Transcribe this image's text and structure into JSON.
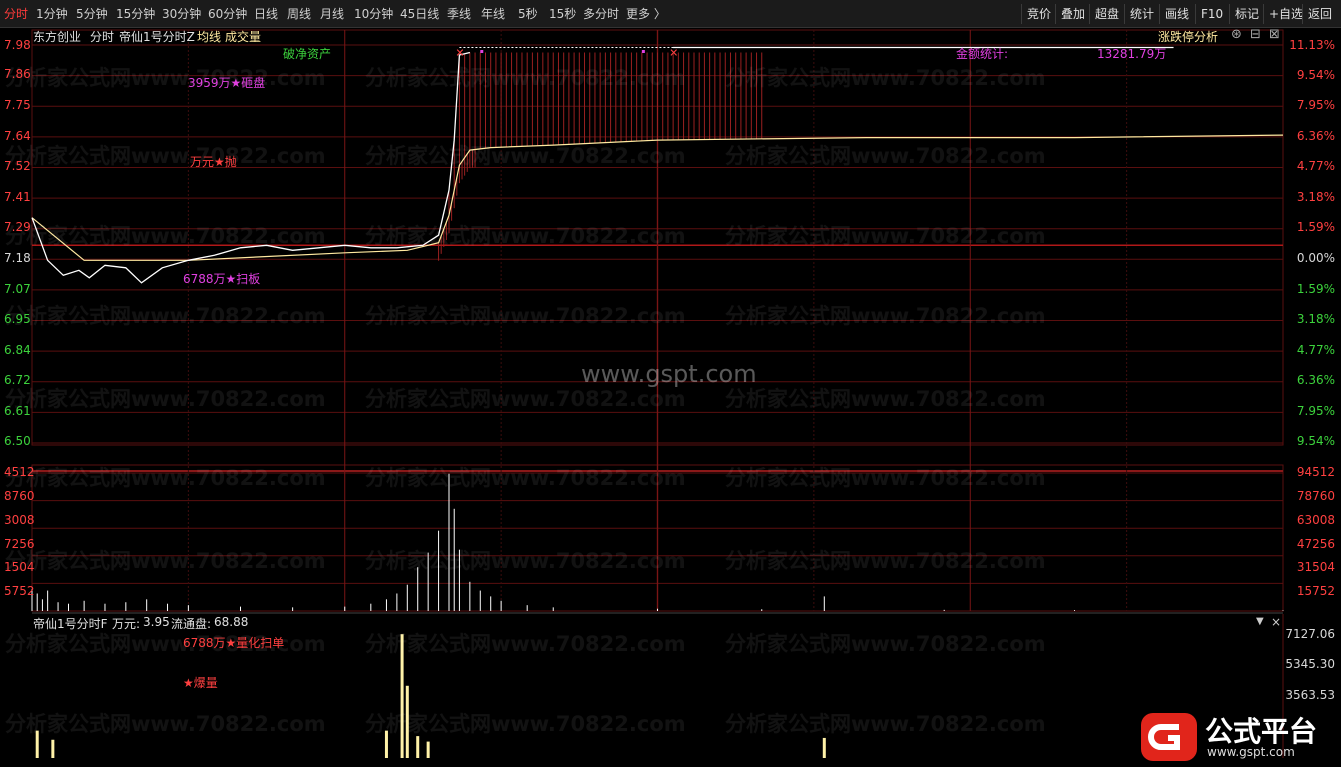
{
  "toolbar": {
    "timeframes": [
      "分时",
      "1分钟",
      "5分钟",
      "15分钟",
      "30分钟",
      "60分钟",
      "日线",
      "周线",
      "月线",
      "10分钟",
      "45日线",
      "季线",
      "年线",
      "5秒",
      "15秒",
      "多分时",
      "更多 〉"
    ],
    "right_buttons": [
      "竞价",
      "叠加",
      "超盘",
      "统计",
      "画线",
      "F10",
      "标记",
      "+自选",
      "返回"
    ]
  },
  "header": {
    "stock": "东方创业",
    "mode": "分时",
    "indicator": "帝仙1号分时Z",
    "avg_label": "均线",
    "vol_label": "成交量",
    "analysis": "涨跌停分析",
    "break_label": "破净资产",
    "amount_label": "金额统计:",
    "amount_value": "13281.79万"
  },
  "annotations": {
    "dump": "3959万★砸盘",
    "sell": "万元★抛",
    "sweep": "6788万★扫板"
  },
  "price_axis": {
    "left": [
      "7.98",
      "7.86",
      "7.75",
      "7.64",
      "7.52",
      "7.41",
      "7.29",
      "7.18",
      "7.07",
      "6.95",
      "6.84",
      "6.72",
      "6.61",
      "6.50"
    ],
    "right": [
      "11.13%",
      "9.54%",
      "7.95%",
      "6.36%",
      "4.77%",
      "3.18%",
      "1.59%",
      "0.00%",
      "1.59%",
      "3.18%",
      "4.77%",
      "6.36%",
      "7.95%",
      "9.54%"
    ]
  },
  "volume_axis": {
    "left": [
      "4512",
      "8760",
      "3008",
      "7256",
      "1504",
      "5752"
    ],
    "right": [
      "94512",
      "78760",
      "63008",
      "47256",
      "31504",
      "15752"
    ]
  },
  "sub": {
    "title": "帝仙1号分时F",
    "wan_label": "万元:",
    "wan_value": "3.95",
    "float_label": "流通盘:",
    "float_value": "68.88",
    "axis": [
      "7127.06",
      "5345.30",
      "3563.53"
    ],
    "ann_top": "6788万★量化扫单",
    "ann_mid": "★爆量"
  },
  "watermark": {
    "text": "分析家公式网www.70822.com",
    "center": "www.gspt.com"
  },
  "logo": {
    "name": "公式平台",
    "url": "www.gspt.com"
  },
  "colors": {
    "up": "#ff4040",
    "down": "#3cd23c",
    "price_line": "#ffffff",
    "avg_line": "#ffe9a0",
    "grid": "#5a0f0f",
    "volume": "#ffffff",
    "sub_bar": "#fff2a8",
    "magenta": "#e040e0"
  },
  "chart_data": {
    "type": "line",
    "prev_close": 7.18,
    "price_range": [
      6.39,
      7.98
    ],
    "minutes": 240,
    "price": [
      [
        0,
        7.29
      ],
      [
        3,
        7.12
      ],
      [
        6,
        7.06
      ],
      [
        9,
        7.08
      ],
      [
        11,
        7.05
      ],
      [
        14,
        7.1
      ],
      [
        18,
        7.09
      ],
      [
        21,
        7.03
      ],
      [
        25,
        7.09
      ],
      [
        30,
        7.12
      ],
      [
        35,
        7.14
      ],
      [
        40,
        7.17
      ],
      [
        45,
        7.18
      ],
      [
        50,
        7.16
      ],
      [
        55,
        7.17
      ],
      [
        60,
        7.18
      ],
      [
        65,
        7.17
      ],
      [
        70,
        7.17
      ],
      [
        75,
        7.18
      ],
      [
        78,
        7.22
      ],
      [
        80,
        7.4
      ],
      [
        81,
        7.6
      ],
      [
        82,
        7.94
      ],
      [
        84,
        7.95
      ],
      [
        240,
        7.95
      ]
    ],
    "avg": [
      [
        0,
        7.29
      ],
      [
        10,
        7.12
      ],
      [
        30,
        7.12
      ],
      [
        60,
        7.15
      ],
      [
        72,
        7.16
      ],
      [
        78,
        7.19
      ],
      [
        80,
        7.3
      ],
      [
        82,
        7.5
      ],
      [
        84,
        7.56
      ],
      [
        88,
        7.57
      ],
      [
        100,
        7.58
      ],
      [
        120,
        7.6
      ],
      [
        160,
        7.61
      ],
      [
        200,
        7.61
      ],
      [
        240,
        7.62
      ]
    ],
    "volume": [
      [
        0,
        15000
      ],
      [
        1,
        12000
      ],
      [
        2,
        8000
      ],
      [
        3,
        14000
      ],
      [
        5,
        6000
      ],
      [
        7,
        5000
      ],
      [
        10,
        7000
      ],
      [
        14,
        5000
      ],
      [
        18,
        6000
      ],
      [
        22,
        8000
      ],
      [
        26,
        5000
      ],
      [
        30,
        4000
      ],
      [
        40,
        3000
      ],
      [
        50,
        2500
      ],
      [
        60,
        3000
      ],
      [
        65,
        5000
      ],
      [
        68,
        8000
      ],
      [
        70,
        12000
      ],
      [
        72,
        18000
      ],
      [
        74,
        30000
      ],
      [
        76,
        40000
      ],
      [
        78,
        55000
      ],
      [
        80,
        94000
      ],
      [
        81,
        70000
      ],
      [
        82,
        42000
      ],
      [
        84,
        20000
      ],
      [
        86,
        14000
      ],
      [
        88,
        10000
      ],
      [
        90,
        7000
      ],
      [
        95,
        4000
      ],
      [
        100,
        2500
      ],
      [
        120,
        1500
      ],
      [
        140,
        1200
      ],
      [
        152,
        10000
      ],
      [
        175,
        800
      ],
      [
        200,
        600
      ],
      [
        240,
        400
      ]
    ],
    "sub_bars": [
      [
        1,
        1500
      ],
      [
        4,
        1000
      ],
      [
        68,
        1500
      ],
      [
        71,
        6788
      ],
      [
        72,
        3959
      ],
      [
        74,
        1200
      ],
      [
        76,
        900
      ],
      [
        152,
        1100
      ]
    ]
  }
}
